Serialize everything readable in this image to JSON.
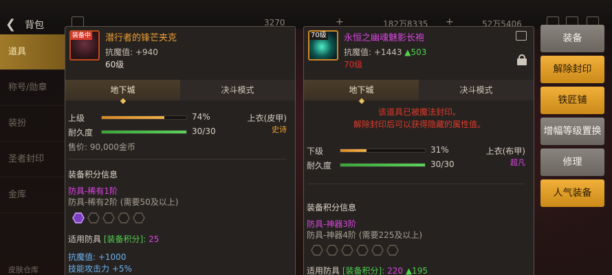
{
  "topbar": {
    "title": "背包",
    "currency_1": "3270",
    "currency_2": "182万8335",
    "currency_3": "52万5406"
  },
  "sidebar": {
    "items": [
      {
        "label": "道具",
        "active": true
      },
      {
        "label": "称号/勋章",
        "active": false
      },
      {
        "label": "装扮",
        "active": false
      },
      {
        "label": "圣者封印",
        "active": false
      },
      {
        "label": "金库",
        "active": false
      }
    ],
    "skin_store": "皮肤仓库"
  },
  "left_panel": {
    "icon_tag": "装备中",
    "name": "潜行者的锋芒夹克",
    "stat_label": "抗魔值:",
    "stat_value": "+940",
    "level": "60级",
    "tabs": [
      "地下城",
      "决斗模式"
    ],
    "grade_label": "上级",
    "grade_pct": "74%",
    "grade_fill": 0.74,
    "slot_label": "上衣(皮甲)",
    "rarity": "史诗",
    "durability_label": "耐久度",
    "durability_value": "30/30",
    "durability_fill": 1.0,
    "price": "售价: 90,000金币",
    "score_section": "装备积分信息",
    "score_tier": "防具-稀有1阶",
    "score_next": "防具-稀有2阶 (需要50及以上)",
    "hex_filled": 1,
    "hex_total": 5,
    "apply_label": "适用防具",
    "apply_bracket": "[装备积分]:",
    "apply_value": "25",
    "bonus_1": "抗魔值: +1000",
    "bonus_2": "技能攻击力 +5%"
  },
  "right_panel": {
    "icon_tag": "70级",
    "name": "永恒之幽魂魅影长袍",
    "stat_label": "抗魔值:",
    "stat_value": "+1443",
    "stat_delta": "▲503",
    "level": "70级",
    "tabs": [
      "地下城",
      "决斗模式"
    ],
    "seal_msg_1": "该道具已被魔法封印。",
    "seal_msg_2": "解除封印后可以获得隐藏的属性值。",
    "grade_label": "下级",
    "grade_pct": "31%",
    "grade_fill": 0.31,
    "slot_label": "上衣(布甲)",
    "rarity": "超凡",
    "durability_label": "耐久度",
    "durability_value": "30/30",
    "durability_fill": 1.0,
    "score_section": "装备积分信息",
    "score_tier": "防具-神器3阶",
    "score_next": "防具-神器4阶 (需要225及以上)",
    "hex_filled": 0,
    "hex_total": 6,
    "apply_label": "适用防具",
    "apply_bracket": "[装备积分]:",
    "apply_value": "220",
    "apply_delta": "▲195"
  },
  "actions": [
    {
      "label": "装备",
      "style": "gray"
    },
    {
      "label": "解除封印",
      "style": "gold"
    },
    {
      "label": "铁匠铺",
      "style": "gold"
    },
    {
      "label": "增幅等级置换",
      "style": "gray"
    },
    {
      "label": "修理",
      "style": "gray"
    },
    {
      "label": "人气装备",
      "style": "gold"
    }
  ],
  "colors": {
    "accent_gold": "#f0b03a",
    "rarity_epic": "#f0a030",
    "rarity_transcendent": "#d945e0",
    "positive": "#52d14f",
    "warning": "#e0302a"
  }
}
